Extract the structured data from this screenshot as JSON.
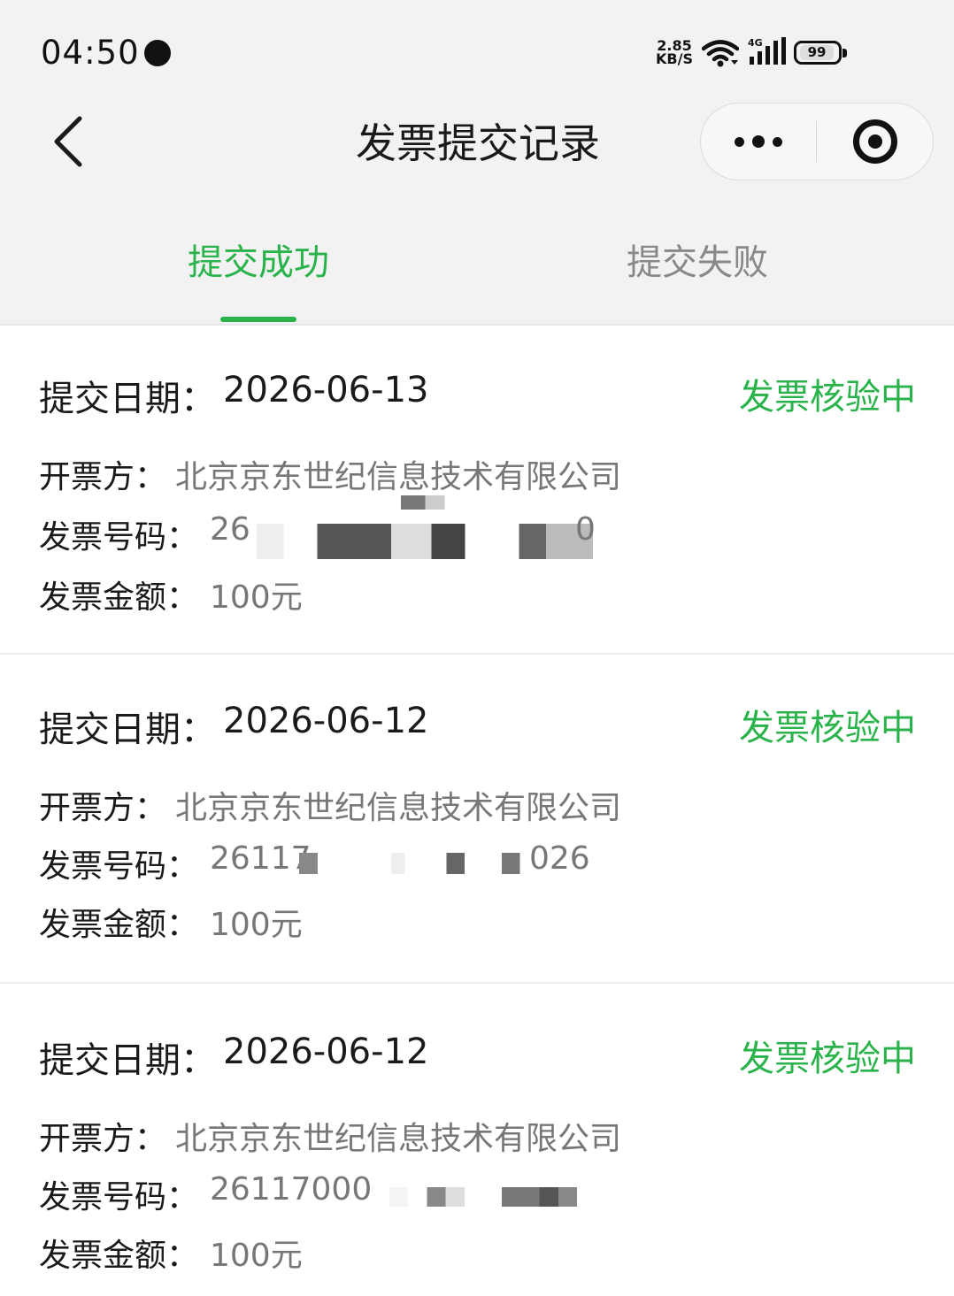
{
  "status_bar": {
    "time": "04:50",
    "net_speed_value": "2.85",
    "net_speed_unit": "KB/S",
    "network_type": "4G",
    "battery": "99"
  },
  "nav": {
    "title": "发票提交记录"
  },
  "tabs": [
    {
      "label": "提交成功",
      "active": true
    },
    {
      "label": "提交失败",
      "active": false
    }
  ],
  "labels": {
    "date": "提交日期：",
    "issuer": "开票方：",
    "number": "发票号码：",
    "amount": "发票金额："
  },
  "records": [
    {
      "date": "2026-06-13",
      "status": "发票核验中",
      "issuer": "北京京东世纪信息技术有限公司",
      "number_start": "26",
      "number_end": "0",
      "amount": "100元"
    },
    {
      "date": "2026-06-12",
      "status": "发票核验中",
      "issuer": "北京京东世纪信息技术有限公司",
      "number_start": "26117",
      "number_end": "026",
      "amount": "100元"
    },
    {
      "date": "2026-06-12",
      "status": "发票核验中",
      "issuer": "北京京东世纪信息技术有限公司",
      "number_start": "26117000",
      "number_end": "",
      "amount": "100元"
    }
  ],
  "colors": {
    "accent": "#2bb34b",
    "header_bg": "#f2f2f2",
    "muted_text": "#777777"
  }
}
